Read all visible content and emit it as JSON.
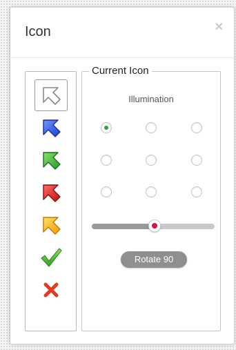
{
  "dialog": {
    "title": "Icon",
    "close_label": "×"
  },
  "palette": {
    "items": [
      {
        "name": "pointer-white-icon",
        "selected": true,
        "color": "#ffffff"
      },
      {
        "name": "pointer-blue-icon",
        "selected": false,
        "color": "#2a59e6"
      },
      {
        "name": "pointer-green-icon",
        "selected": false,
        "color": "#3bb83b"
      },
      {
        "name": "pointer-red-icon",
        "selected": false,
        "color": "#dd2222"
      },
      {
        "name": "pointer-yellow-icon",
        "selected": false,
        "color": "#f4b400"
      },
      {
        "name": "checkmark-icon",
        "selected": false,
        "color": "#45b52a"
      },
      {
        "name": "cross-icon",
        "selected": false,
        "color": "#e23a1c"
      }
    ]
  },
  "current_icon": {
    "legend": "Current Icon",
    "illumination_label": "Illumination",
    "illumination_selected": 0,
    "illumination_count": 9,
    "rotation_fraction": 0.51,
    "rotate_button_label": "Rotate 90"
  },
  "colors": {
    "radio_checked": "#2aa53b",
    "slider_thumb_dot": "#d6143a",
    "button_bg": "#8f8f8f"
  }
}
